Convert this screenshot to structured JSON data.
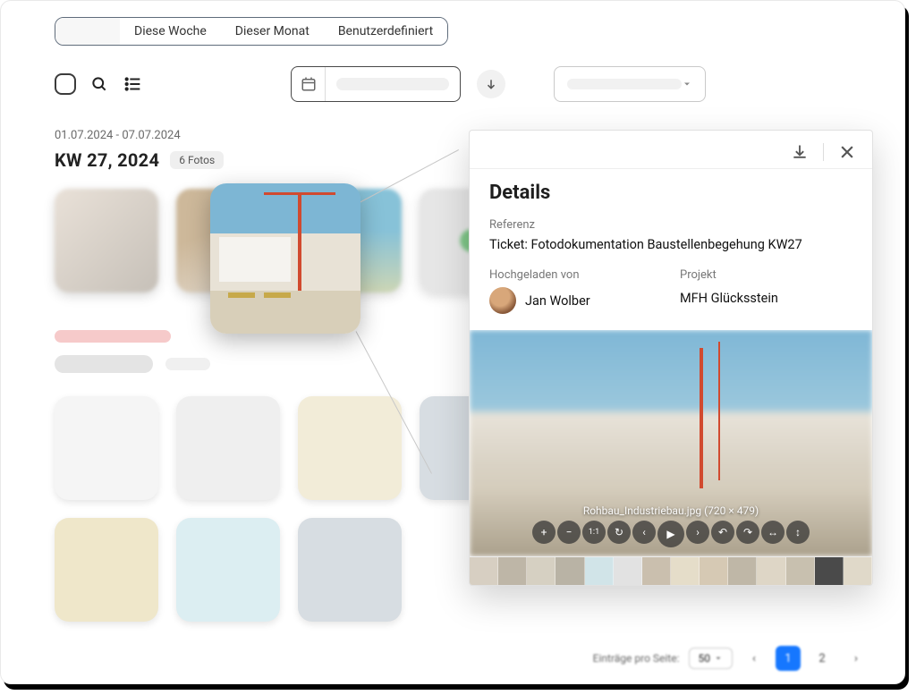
{
  "tabs": {
    "active": "",
    "this_week": "Diese Woche",
    "this_month": "Dieser Monat",
    "custom": "Benutzerdefiniert"
  },
  "week": {
    "range": "01.07.2024 - 07.07.2024",
    "title": "KW 27, 2024",
    "count": "6 Fotos"
  },
  "details": {
    "title": "Details",
    "reference_label": "Referenz",
    "reference_value": "Ticket: Fotodokumentation Baustellenbegehung KW27",
    "uploaded_by_label": "Hochgeladen von",
    "uploaded_by_value": "Jan Wolber",
    "project_label": "Projekt",
    "project_value": "MFH Glücksstein",
    "caption": "Rohbau_Industriebau.jpg (720 × 479)"
  },
  "pagination": {
    "label": "Einträge pro Seite:",
    "page_size": "50",
    "page_1": "1",
    "page_2": "2"
  },
  "viewer_controls": {
    "zoom_in": "+",
    "zoom_out": "−",
    "one_to_one": "1:1",
    "rotate": "↻",
    "prev": "‹",
    "play": "▶",
    "next": "›",
    "undo": "↶",
    "redo": "↷",
    "flip_h": "↔",
    "flip_v": "↕"
  },
  "mini_colors": [
    "#d7cfc2",
    "#beb6a7",
    "#d6d0c2",
    "#b9b3a5",
    "#d1e4e8",
    "#e2e2e2",
    "#cabfae",
    "#e5ddc9",
    "#d6c9b4",
    "#bfb7a7",
    "#ded6c6",
    "#c8c0af",
    "#4a4a4a",
    "#e0d9c9"
  ]
}
